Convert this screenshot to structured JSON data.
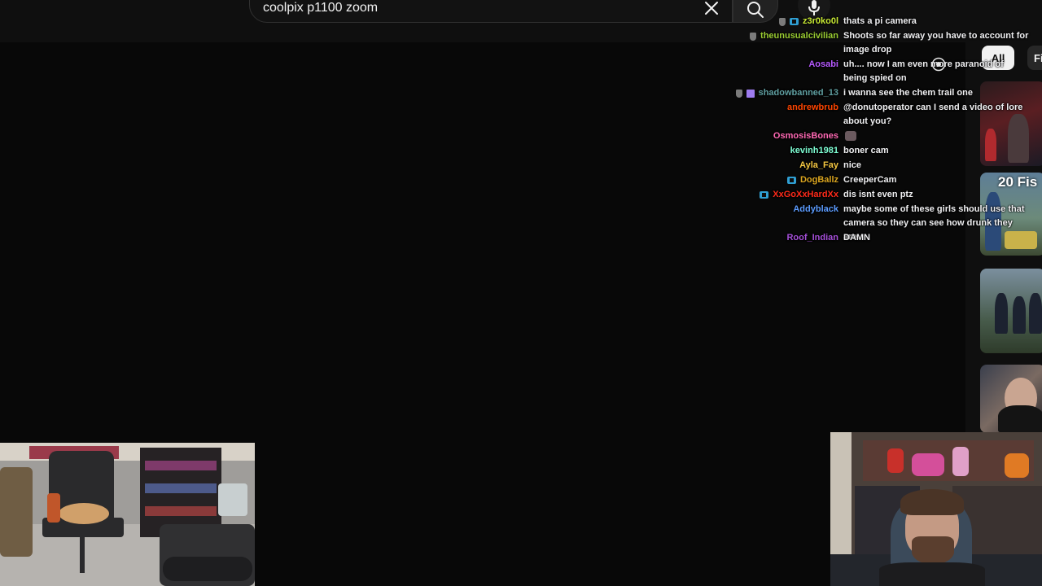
{
  "search": {
    "query": "coolpix p1100 zoom"
  },
  "icons": {
    "clear": "close-icon",
    "search": "search-icon",
    "mic": "microphone-icon",
    "cursor": "pointer-circle-icon"
  },
  "chips": {
    "all": "All",
    "next": "Fi"
  },
  "side": {
    "thumb2_text": "20 Fis"
  },
  "chat": [
    {
      "user": "z3r0ko0l",
      "color": "#c7e834",
      "badges": [
        "shield",
        "prime"
      ],
      "message": "thats a pi camera"
    },
    {
      "user": "theunusualcivilian",
      "color": "#9acd32",
      "badges": [
        "shield"
      ],
      "message": "Shoots so far away you have to account for image drop"
    },
    {
      "user": "Aosabi",
      "color": "#b65aff",
      "badges": [],
      "message": "uh.... now I am even more paranoid of being spied on"
    },
    {
      "user": "shadowbanned_13",
      "color": "#5f9ea0",
      "badges": [
        "shield",
        "gift"
      ],
      "message": "i wanna see the chem trail one"
    },
    {
      "user": "andrewbrub",
      "color": "#ff4500",
      "badges": [],
      "message": "@donutoperator can I send a video of lore about you?"
    },
    {
      "user": "OsmosisBones",
      "color": "#ff69b4",
      "badges": [],
      "message": "",
      "emote": "hand-emote"
    },
    {
      "user": "kevinh1981",
      "color": "#7fffd4",
      "badges": [],
      "message": "boner cam"
    },
    {
      "user": "Ayla_Fay",
      "color": "#f5c842",
      "badges": [],
      "message": "nice"
    },
    {
      "user": "DogBallz",
      "color": "#daa520",
      "badges": [
        "prime"
      ],
      "message": "CreeperCam"
    },
    {
      "user": "XxGoXxHardXx",
      "color": "#ff2a1a",
      "badges": [
        "prime"
      ],
      "message": "dis isnt even ptz"
    },
    {
      "user": "Addyblack",
      "color": "#5c9cff",
      "badges": [],
      "message": "maybe some of these girls should use that camera so they can see how drunk they are."
    },
    {
      "user": "Roof_Indian",
      "color": "#a54fd8",
      "badges": [],
      "message": "DAMN"
    }
  ]
}
